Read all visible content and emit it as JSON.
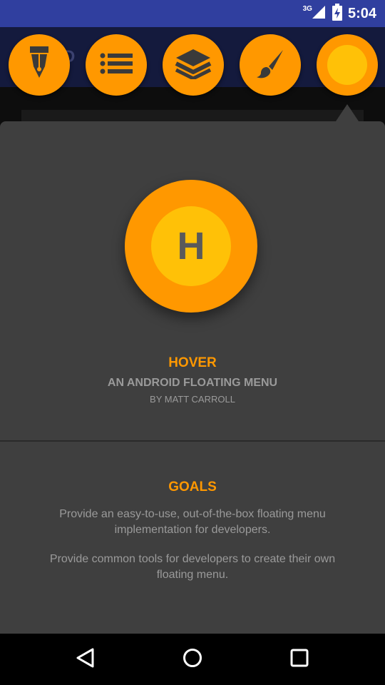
{
  "status_bar": {
    "network": "3G",
    "time": "5:04",
    "icons": [
      "signal-icon",
      "battery-icon"
    ]
  },
  "background_app": {
    "title_fragment": "r D"
  },
  "tabs": [
    {
      "icon": "fountain-pen-icon"
    },
    {
      "icon": "list-icon"
    },
    {
      "icon": "layers-icon"
    },
    {
      "icon": "paintbrush-icon"
    },
    {
      "icon": "hover-logo-icon",
      "selected": true
    }
  ],
  "panel": {
    "logo_letter": "H",
    "title": "HOVER",
    "subtitle": "AN ANDROID FLOATING MENU",
    "byline": "BY MATT CARROLL",
    "goals_title": "GOALS",
    "goals": [
      "Provide an easy-to-use, out-of-the-box floating menu implementation for developers.",
      "Provide common tools for developers to create their own floating menu."
    ]
  },
  "nav_bar": {
    "icons": [
      "back-icon",
      "home-icon",
      "recents-icon"
    ]
  },
  "colors": {
    "accent": "#ff9800",
    "accent_light": "#ffc107",
    "panel": "#3f3f3f",
    "status_bar": "#303f9f"
  }
}
